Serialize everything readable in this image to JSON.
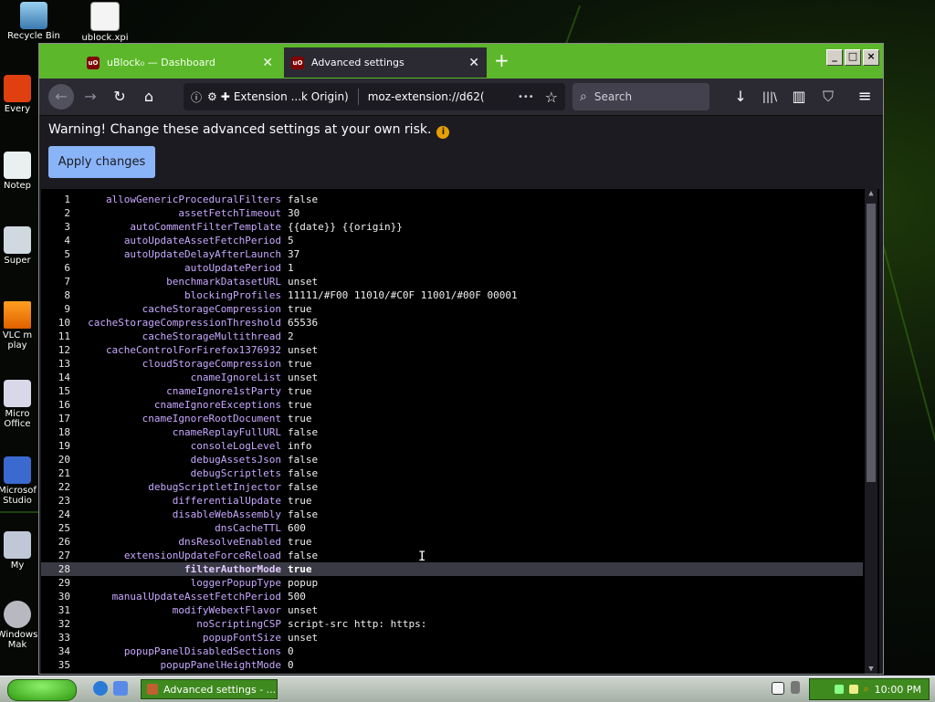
{
  "desktop": {
    "icons": [
      {
        "label": "Recycle Bin"
      },
      {
        "label": "ublock.xpi"
      },
      {
        "label": "Every"
      },
      {
        "label": "Notep"
      },
      {
        "label": "Super"
      },
      {
        "label": "VLC m"
      },
      {
        "label": "play"
      },
      {
        "label": "Micro"
      },
      {
        "label": "Office"
      },
      {
        "label": "Microsof"
      },
      {
        "label": "Studio"
      },
      {
        "label": "My"
      },
      {
        "label": "Windows"
      },
      {
        "label": "Mak"
      }
    ]
  },
  "browser": {
    "tabs": [
      {
        "title": "uBlock₀ — Dashboard",
        "close": "✕"
      },
      {
        "title": "Advanced settings",
        "close": "✕"
      }
    ],
    "new_tab": "+",
    "url_identity": "Extension ...k Origin)",
    "url": "moz-extension://d62(",
    "search_placeholder": "Search",
    "icons": {
      "ublock_badge": "uO",
      "back": "←",
      "forward": "→",
      "reload": "↻",
      "home": "⌂",
      "menu_dots": "•••",
      "bookmark": "☆",
      "download": "↓",
      "library": "|||\\",
      "sidebar": "▥",
      "shield": "⛉",
      "hamburger": "≡"
    }
  },
  "page": {
    "warning": "Warning! Change these advanced settings at your own risk.",
    "apply_label": "Apply changes",
    "active_line": 28,
    "settings": [
      {
        "n": "1",
        "key": "allowGenericProceduralFilters",
        "val": "false"
      },
      {
        "n": "2",
        "key": "assetFetchTimeout",
        "val": "30"
      },
      {
        "n": "3",
        "key": "autoCommentFilterTemplate",
        "val": "{{date}} {{origin}}"
      },
      {
        "n": "4",
        "key": "autoUpdateAssetFetchPeriod",
        "val": "5"
      },
      {
        "n": "5",
        "key": "autoUpdateDelayAfterLaunch",
        "val": "37"
      },
      {
        "n": "6",
        "key": "autoUpdatePeriod",
        "val": "1"
      },
      {
        "n": "7",
        "key": "benchmarkDatasetURL",
        "val": "unset"
      },
      {
        "n": "8",
        "key": "blockingProfiles",
        "val": "11111/#F00 11010/#C0F 11001/#00F 00001"
      },
      {
        "n": "9",
        "key": "cacheStorageCompression",
        "val": "true"
      },
      {
        "n": "10",
        "key": "cacheStorageCompressionThreshold",
        "val": "65536"
      },
      {
        "n": "11",
        "key": "cacheStorageMultithread",
        "val": "2"
      },
      {
        "n": "12",
        "key": "cacheControlForFirefox1376932",
        "val": "unset"
      },
      {
        "n": "13",
        "key": "cloudStorageCompression",
        "val": "true"
      },
      {
        "n": "14",
        "key": "cnameIgnoreList",
        "val": "unset"
      },
      {
        "n": "15",
        "key": "cnameIgnore1stParty",
        "val": "true"
      },
      {
        "n": "16",
        "key": "cnameIgnoreExceptions",
        "val": "true"
      },
      {
        "n": "17",
        "key": "cnameIgnoreRootDocument",
        "val": "true"
      },
      {
        "n": "18",
        "key": "cnameReplayFullURL",
        "val": "false"
      },
      {
        "n": "19",
        "key": "consoleLogLevel",
        "val": "info"
      },
      {
        "n": "20",
        "key": "debugAssetsJson",
        "val": "false"
      },
      {
        "n": "21",
        "key": "debugScriptlets",
        "val": "false"
      },
      {
        "n": "22",
        "key": "debugScriptletInjector",
        "val": "false"
      },
      {
        "n": "23",
        "key": "differentialUpdate",
        "val": "true"
      },
      {
        "n": "24",
        "key": "disableWebAssembly",
        "val": "false"
      },
      {
        "n": "25",
        "key": "dnsCacheTTL",
        "val": "600"
      },
      {
        "n": "26",
        "key": "dnsResolveEnabled",
        "val": "true"
      },
      {
        "n": "27",
        "key": "extensionUpdateForceReload",
        "val": "false"
      },
      {
        "n": "28",
        "key": "filterAuthorMode",
        "val": "true"
      },
      {
        "n": "29",
        "key": "loggerPopupType",
        "val": "popup"
      },
      {
        "n": "30",
        "key": "manualUpdateAssetFetchPeriod",
        "val": "500"
      },
      {
        "n": "31",
        "key": "modifyWebextFlavor",
        "val": "unset"
      },
      {
        "n": "32",
        "key": "noScriptingCSP",
        "val": "script-src http: https:"
      },
      {
        "n": "33",
        "key": "popupFontSize",
        "val": "unset"
      },
      {
        "n": "34",
        "key": "popupPanelDisabledSections",
        "val": "0"
      },
      {
        "n": "35",
        "key": "popupPanelHeightMode",
        "val": "0"
      }
    ]
  },
  "taskbar": {
    "task_label": "Advanced settings - ...",
    "clock": "10:00 PM"
  },
  "colors": {
    "tabbar": "#5cb82a",
    "editor_bg": "#000000",
    "key_color": "#c8a8ff",
    "apply_button": "#8ab4f8"
  }
}
